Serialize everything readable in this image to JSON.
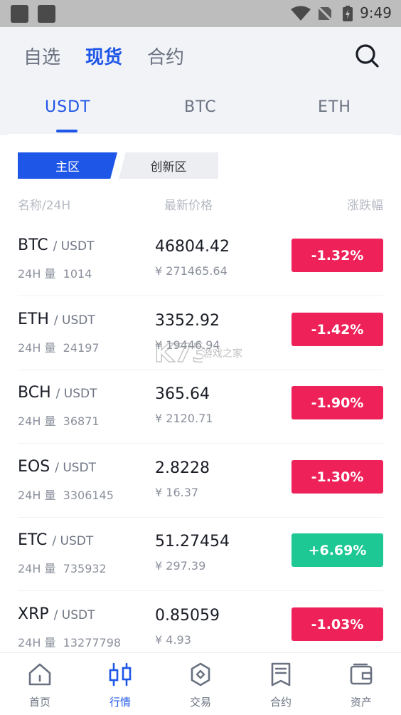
{
  "status_bar": {
    "time": "9:49"
  },
  "header": {
    "tabs": [
      {
        "label": "自选"
      },
      {
        "label": "现货"
      },
      {
        "label": "合约"
      }
    ],
    "active_tab": "现货"
  },
  "quote_tabs": [
    {
      "label": "USDT"
    },
    {
      "label": "BTC"
    },
    {
      "label": "ETH"
    }
  ],
  "zones": {
    "main": "主区",
    "innovation": "创新区"
  },
  "columns": {
    "name": "名称/24H",
    "price": "最新价格",
    "change": "涨跌幅"
  },
  "markets": [
    {
      "base": "BTC",
      "quote": "/ USDT",
      "volume_label": "24H 量",
      "volume": "1014",
      "price": "46804.42",
      "cny": "¥ 271465.64",
      "change": "-1.32%",
      "direction": "down"
    },
    {
      "base": "ETH",
      "quote": "/ USDT",
      "volume_label": "24H 量",
      "volume": "24197",
      "price": "3352.92",
      "cny": "¥ 19446.94",
      "change": "-1.42%",
      "direction": "down"
    },
    {
      "base": "BCH",
      "quote": "/ USDT",
      "volume_label": "24H 量",
      "volume": "36871",
      "price": "365.64",
      "cny": "¥ 2120.71",
      "change": "-1.90%",
      "direction": "down"
    },
    {
      "base": "EOS",
      "quote": "/ USDT",
      "volume_label": "24H 量",
      "volume": "3306145",
      "price": "2.8228",
      "cny": "¥ 16.37",
      "change": "-1.30%",
      "direction": "down"
    },
    {
      "base": "ETC",
      "quote": "/ USDT",
      "volume_label": "24H 量",
      "volume": "735932",
      "price": "51.27454",
      "cny": "¥ 297.39",
      "change": "+6.69%",
      "direction": "up"
    },
    {
      "base": "XRP",
      "quote": "/ USDT",
      "volume_label": "24H 量",
      "volume": "13277798",
      "price": "0.85059",
      "cny": "¥ 4.93",
      "change": "-1.03%",
      "direction": "down"
    }
  ],
  "watermark": {
    "text": "游戏之家"
  },
  "bottom_nav": [
    {
      "label": "首页",
      "icon": "home-icon"
    },
    {
      "label": "行情",
      "icon": "candlestick-icon"
    },
    {
      "label": "交易",
      "icon": "trade-icon"
    },
    {
      "label": "合约",
      "icon": "contract-icon"
    },
    {
      "label": "资产",
      "icon": "wallet-icon"
    }
  ],
  "colors": {
    "accent": "#1e56e8",
    "down": "#ee2159",
    "up": "#1dc894"
  }
}
